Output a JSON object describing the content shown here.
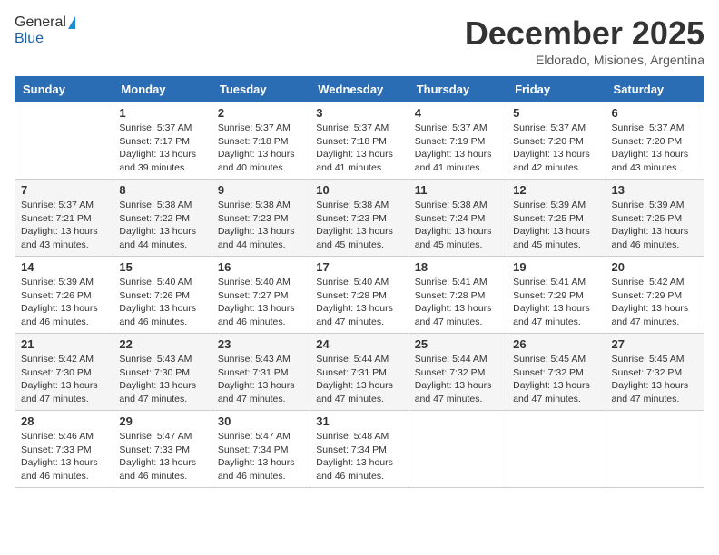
{
  "logo": {
    "general": "General",
    "blue": "Blue"
  },
  "title": "December 2025",
  "location": "Eldorado, Misiones, Argentina",
  "days_header": [
    "Sunday",
    "Monday",
    "Tuesday",
    "Wednesday",
    "Thursday",
    "Friday",
    "Saturday"
  ],
  "weeks": [
    [
      {
        "num": "",
        "sunrise": "",
        "sunset": "",
        "daylight": ""
      },
      {
        "num": "1",
        "sunrise": "Sunrise: 5:37 AM",
        "sunset": "Sunset: 7:17 PM",
        "daylight": "Daylight: 13 hours and 39 minutes."
      },
      {
        "num": "2",
        "sunrise": "Sunrise: 5:37 AM",
        "sunset": "Sunset: 7:18 PM",
        "daylight": "Daylight: 13 hours and 40 minutes."
      },
      {
        "num": "3",
        "sunrise": "Sunrise: 5:37 AM",
        "sunset": "Sunset: 7:18 PM",
        "daylight": "Daylight: 13 hours and 41 minutes."
      },
      {
        "num": "4",
        "sunrise": "Sunrise: 5:37 AM",
        "sunset": "Sunset: 7:19 PM",
        "daylight": "Daylight: 13 hours and 41 minutes."
      },
      {
        "num": "5",
        "sunrise": "Sunrise: 5:37 AM",
        "sunset": "Sunset: 7:20 PM",
        "daylight": "Daylight: 13 hours and 42 minutes."
      },
      {
        "num": "6",
        "sunrise": "Sunrise: 5:37 AM",
        "sunset": "Sunset: 7:20 PM",
        "daylight": "Daylight: 13 hours and 43 minutes."
      }
    ],
    [
      {
        "num": "7",
        "sunrise": "Sunrise: 5:37 AM",
        "sunset": "Sunset: 7:21 PM",
        "daylight": "Daylight: 13 hours and 43 minutes."
      },
      {
        "num": "8",
        "sunrise": "Sunrise: 5:38 AM",
        "sunset": "Sunset: 7:22 PM",
        "daylight": "Daylight: 13 hours and 44 minutes."
      },
      {
        "num": "9",
        "sunrise": "Sunrise: 5:38 AM",
        "sunset": "Sunset: 7:23 PM",
        "daylight": "Daylight: 13 hours and 44 minutes."
      },
      {
        "num": "10",
        "sunrise": "Sunrise: 5:38 AM",
        "sunset": "Sunset: 7:23 PM",
        "daylight": "Daylight: 13 hours and 45 minutes."
      },
      {
        "num": "11",
        "sunrise": "Sunrise: 5:38 AM",
        "sunset": "Sunset: 7:24 PM",
        "daylight": "Daylight: 13 hours and 45 minutes."
      },
      {
        "num": "12",
        "sunrise": "Sunrise: 5:39 AM",
        "sunset": "Sunset: 7:25 PM",
        "daylight": "Daylight: 13 hours and 45 minutes."
      },
      {
        "num": "13",
        "sunrise": "Sunrise: 5:39 AM",
        "sunset": "Sunset: 7:25 PM",
        "daylight": "Daylight: 13 hours and 46 minutes."
      }
    ],
    [
      {
        "num": "14",
        "sunrise": "Sunrise: 5:39 AM",
        "sunset": "Sunset: 7:26 PM",
        "daylight": "Daylight: 13 hours and 46 minutes."
      },
      {
        "num": "15",
        "sunrise": "Sunrise: 5:40 AM",
        "sunset": "Sunset: 7:26 PM",
        "daylight": "Daylight: 13 hours and 46 minutes."
      },
      {
        "num": "16",
        "sunrise": "Sunrise: 5:40 AM",
        "sunset": "Sunset: 7:27 PM",
        "daylight": "Daylight: 13 hours and 46 minutes."
      },
      {
        "num": "17",
        "sunrise": "Sunrise: 5:40 AM",
        "sunset": "Sunset: 7:28 PM",
        "daylight": "Daylight: 13 hours and 47 minutes."
      },
      {
        "num": "18",
        "sunrise": "Sunrise: 5:41 AM",
        "sunset": "Sunset: 7:28 PM",
        "daylight": "Daylight: 13 hours and 47 minutes."
      },
      {
        "num": "19",
        "sunrise": "Sunrise: 5:41 AM",
        "sunset": "Sunset: 7:29 PM",
        "daylight": "Daylight: 13 hours and 47 minutes."
      },
      {
        "num": "20",
        "sunrise": "Sunrise: 5:42 AM",
        "sunset": "Sunset: 7:29 PM",
        "daylight": "Daylight: 13 hours and 47 minutes."
      }
    ],
    [
      {
        "num": "21",
        "sunrise": "Sunrise: 5:42 AM",
        "sunset": "Sunset: 7:30 PM",
        "daylight": "Daylight: 13 hours and 47 minutes."
      },
      {
        "num": "22",
        "sunrise": "Sunrise: 5:43 AM",
        "sunset": "Sunset: 7:30 PM",
        "daylight": "Daylight: 13 hours and 47 minutes."
      },
      {
        "num": "23",
        "sunrise": "Sunrise: 5:43 AM",
        "sunset": "Sunset: 7:31 PM",
        "daylight": "Daylight: 13 hours and 47 minutes."
      },
      {
        "num": "24",
        "sunrise": "Sunrise: 5:44 AM",
        "sunset": "Sunset: 7:31 PM",
        "daylight": "Daylight: 13 hours and 47 minutes."
      },
      {
        "num": "25",
        "sunrise": "Sunrise: 5:44 AM",
        "sunset": "Sunset: 7:32 PM",
        "daylight": "Daylight: 13 hours and 47 minutes."
      },
      {
        "num": "26",
        "sunrise": "Sunrise: 5:45 AM",
        "sunset": "Sunset: 7:32 PM",
        "daylight": "Daylight: 13 hours and 47 minutes."
      },
      {
        "num": "27",
        "sunrise": "Sunrise: 5:45 AM",
        "sunset": "Sunset: 7:32 PM",
        "daylight": "Daylight: 13 hours and 47 minutes."
      }
    ],
    [
      {
        "num": "28",
        "sunrise": "Sunrise: 5:46 AM",
        "sunset": "Sunset: 7:33 PM",
        "daylight": "Daylight: 13 hours and 46 minutes."
      },
      {
        "num": "29",
        "sunrise": "Sunrise: 5:47 AM",
        "sunset": "Sunset: 7:33 PM",
        "daylight": "Daylight: 13 hours and 46 minutes."
      },
      {
        "num": "30",
        "sunrise": "Sunrise: 5:47 AM",
        "sunset": "Sunset: 7:34 PM",
        "daylight": "Daylight: 13 hours and 46 minutes."
      },
      {
        "num": "31",
        "sunrise": "Sunrise: 5:48 AM",
        "sunset": "Sunset: 7:34 PM",
        "daylight": "Daylight: 13 hours and 46 minutes."
      },
      {
        "num": "",
        "sunrise": "",
        "sunset": "",
        "daylight": ""
      },
      {
        "num": "",
        "sunrise": "",
        "sunset": "",
        "daylight": ""
      },
      {
        "num": "",
        "sunrise": "",
        "sunset": "",
        "daylight": ""
      }
    ]
  ]
}
